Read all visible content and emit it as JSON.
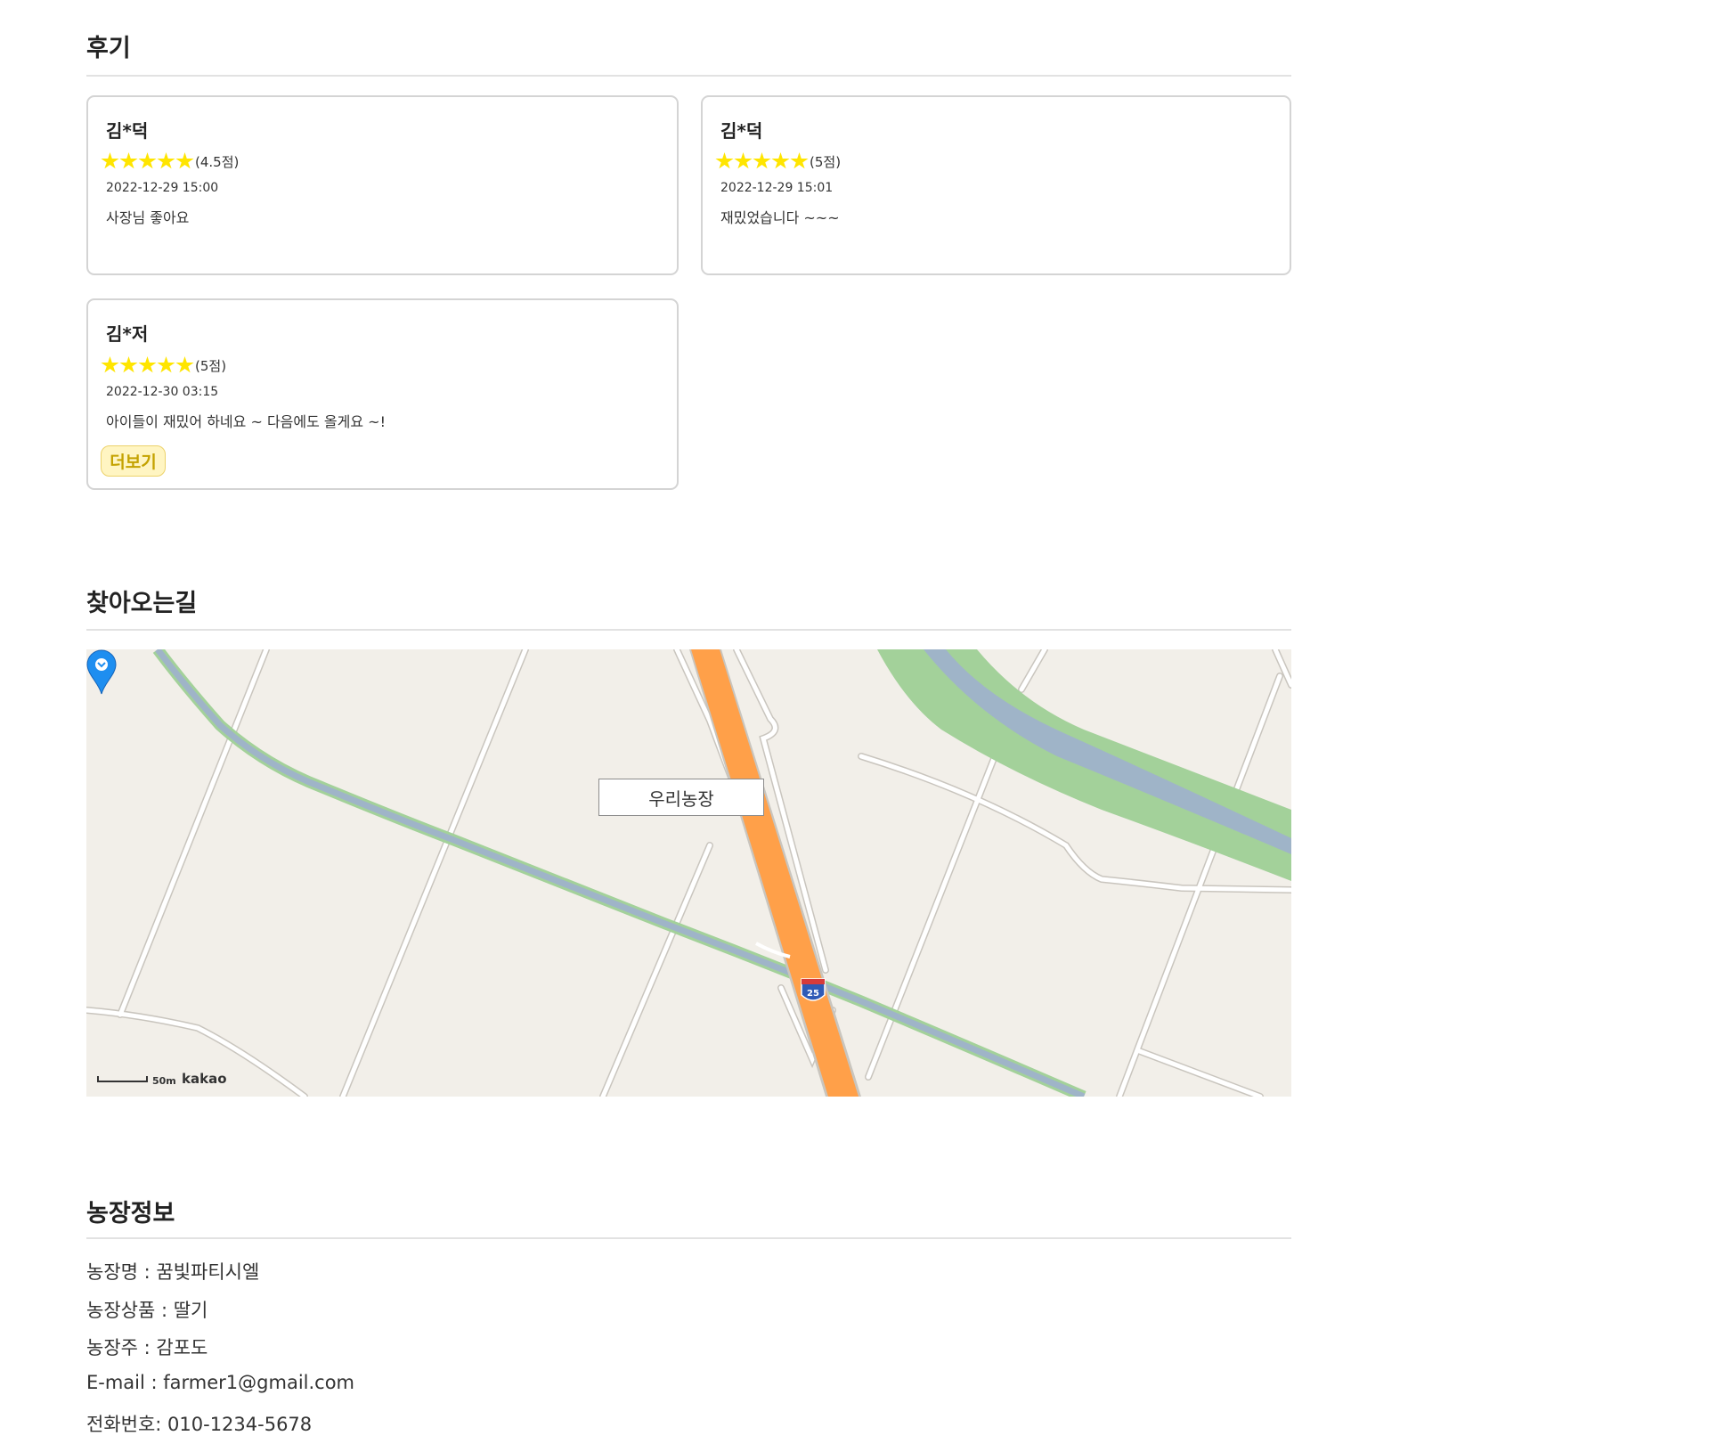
{
  "reviews": {
    "title": "후기",
    "items": [
      {
        "name": "김*덕",
        "rating": 4.5,
        "score_label": "(4.5점)",
        "date": "2022-12-29 15:00",
        "text": "사장님 좋아요"
      },
      {
        "name": "김*덕",
        "rating": 5,
        "score_label": "(5점)",
        "date": "2022-12-29 15:01",
        "text": "재밌었습니다 ~~~"
      },
      {
        "name": "김*저",
        "rating": 5,
        "score_label": "(5점)",
        "date": "2022-12-30 03:15",
        "text": "아이들이 재밌어 하네요 ~ 다음에도 올게요 ~!"
      }
    ],
    "more_label": "더보기"
  },
  "directions": {
    "title": "찾아오는길",
    "map": {
      "marker_label": "우리농장",
      "highway_number": "25",
      "scale_label": "50m",
      "provider": "kakao"
    }
  },
  "farm_info": {
    "title": "농장정보",
    "lines": [
      "농장명 : 꿈빛파티시엘",
      "농장상품 : 딸기",
      "농장주 : 감포도",
      "E-mail : farmer1@gmail.com",
      "전화번호: 010-1234-5678"
    ]
  },
  "colors": {
    "star": "#ffe500",
    "more_button_bg": "#fff5c2",
    "more_button_text": "#c4a200",
    "map_land": "#f2efe9",
    "map_highway": "#ffa049",
    "map_water": "#9fb4c8",
    "map_green": "#a3d19a",
    "map_pin": "#1e8ef0"
  },
  "icons": {
    "star": "star-icon",
    "marker": "map-marker-icon",
    "highway_shield": "highway-shield-icon"
  }
}
